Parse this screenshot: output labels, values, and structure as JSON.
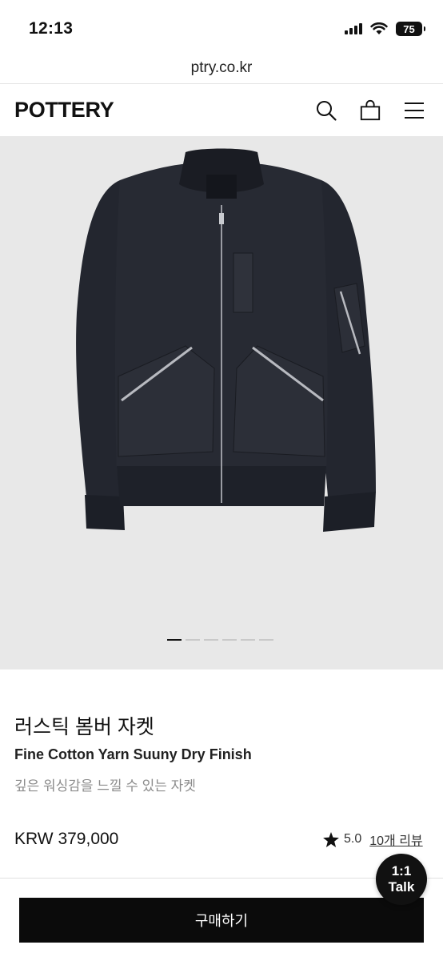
{
  "status_bar": {
    "time": "12:13",
    "battery": "75",
    "icons": [
      "signal-icon",
      "wifi-icon",
      "battery-icon"
    ]
  },
  "browser": {
    "url": "ptry.co.kr"
  },
  "header": {
    "logo": "POTTERY",
    "icons": [
      "search-icon",
      "shopping-bag-icon",
      "menu-icon"
    ]
  },
  "gallery": {
    "image_subject": "jacket",
    "pager_count": 6,
    "active_index": 0
  },
  "product": {
    "title": "러스틱 봄버 자켓",
    "subtitle": "Fine Cotton Yarn Suuny Dry Finish",
    "description": "깊은 워싱감을 느낄 수 있는 자켓",
    "price": "KRW 379,000",
    "rating": "5.0",
    "reviews": "10개 리뷰"
  },
  "actions": {
    "buy_label": "구매하기",
    "talk_line1": "1:1",
    "talk_line2": "Talk"
  },
  "colors": {
    "hero_bg": "#e8e8e8",
    "button_bg": "#0b0b0b",
    "text_muted": "#8c8c8c"
  }
}
